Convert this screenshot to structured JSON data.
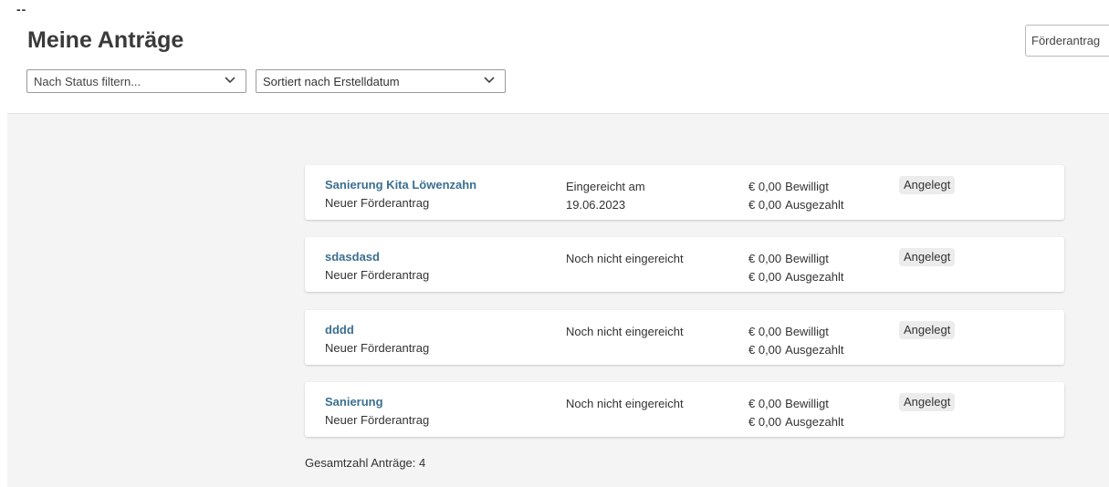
{
  "header": {
    "mark": "--",
    "title": "Meine Anträge",
    "new_button_label": "Förderantrag"
  },
  "filters": {
    "status_placeholder": "Nach Status filtern...",
    "sort_value": "Sortiert nach Erstelldatum"
  },
  "applications": [
    {
      "name": "Sanierung Kita Löwenzahn",
      "type": "Neuer Förderantrag",
      "submitted_line1": "Eingereicht am",
      "submitted_line2": "19.06.2023",
      "approved_amount": "€ 0,00",
      "approved_label": "Bewilligt",
      "paid_amount": "€ 0,00",
      "paid_label": "Ausgezahlt",
      "status": "Angelegt"
    },
    {
      "name": "sdasdasd",
      "type": "Neuer Förderantrag",
      "submitted_line1": "Noch nicht eingereicht",
      "submitted_line2": "",
      "approved_amount": "€ 0,00",
      "approved_label": "Bewilligt",
      "paid_amount": "€ 0,00",
      "paid_label": "Ausgezahlt",
      "status": "Angelegt"
    },
    {
      "name": "dddd",
      "type": "Neuer Förderantrag",
      "submitted_line1": "Noch nicht eingereicht",
      "submitted_line2": "",
      "approved_amount": "€ 0,00",
      "approved_label": "Bewilligt",
      "paid_amount": "€ 0,00",
      "paid_label": "Ausgezahlt",
      "status": "Angelegt"
    },
    {
      "name": "Sanierung",
      "type": "Neuer Förderantrag",
      "submitted_line1": "Noch nicht eingereicht",
      "submitted_line2": "",
      "approved_amount": "€ 0,00",
      "approved_label": "Bewilligt",
      "paid_amount": "€ 0,00",
      "paid_label": "Ausgezahlt",
      "status": "Angelegt"
    }
  ],
  "footer": {
    "total_text": "Gesamtzahl Anträge: 4"
  },
  "icons": {
    "select_chevron": "chevron-down-icon"
  },
  "colors": {
    "link": "#3b6f91",
    "content_background": "#f4f4f4",
    "badge_background": "#ececec"
  }
}
